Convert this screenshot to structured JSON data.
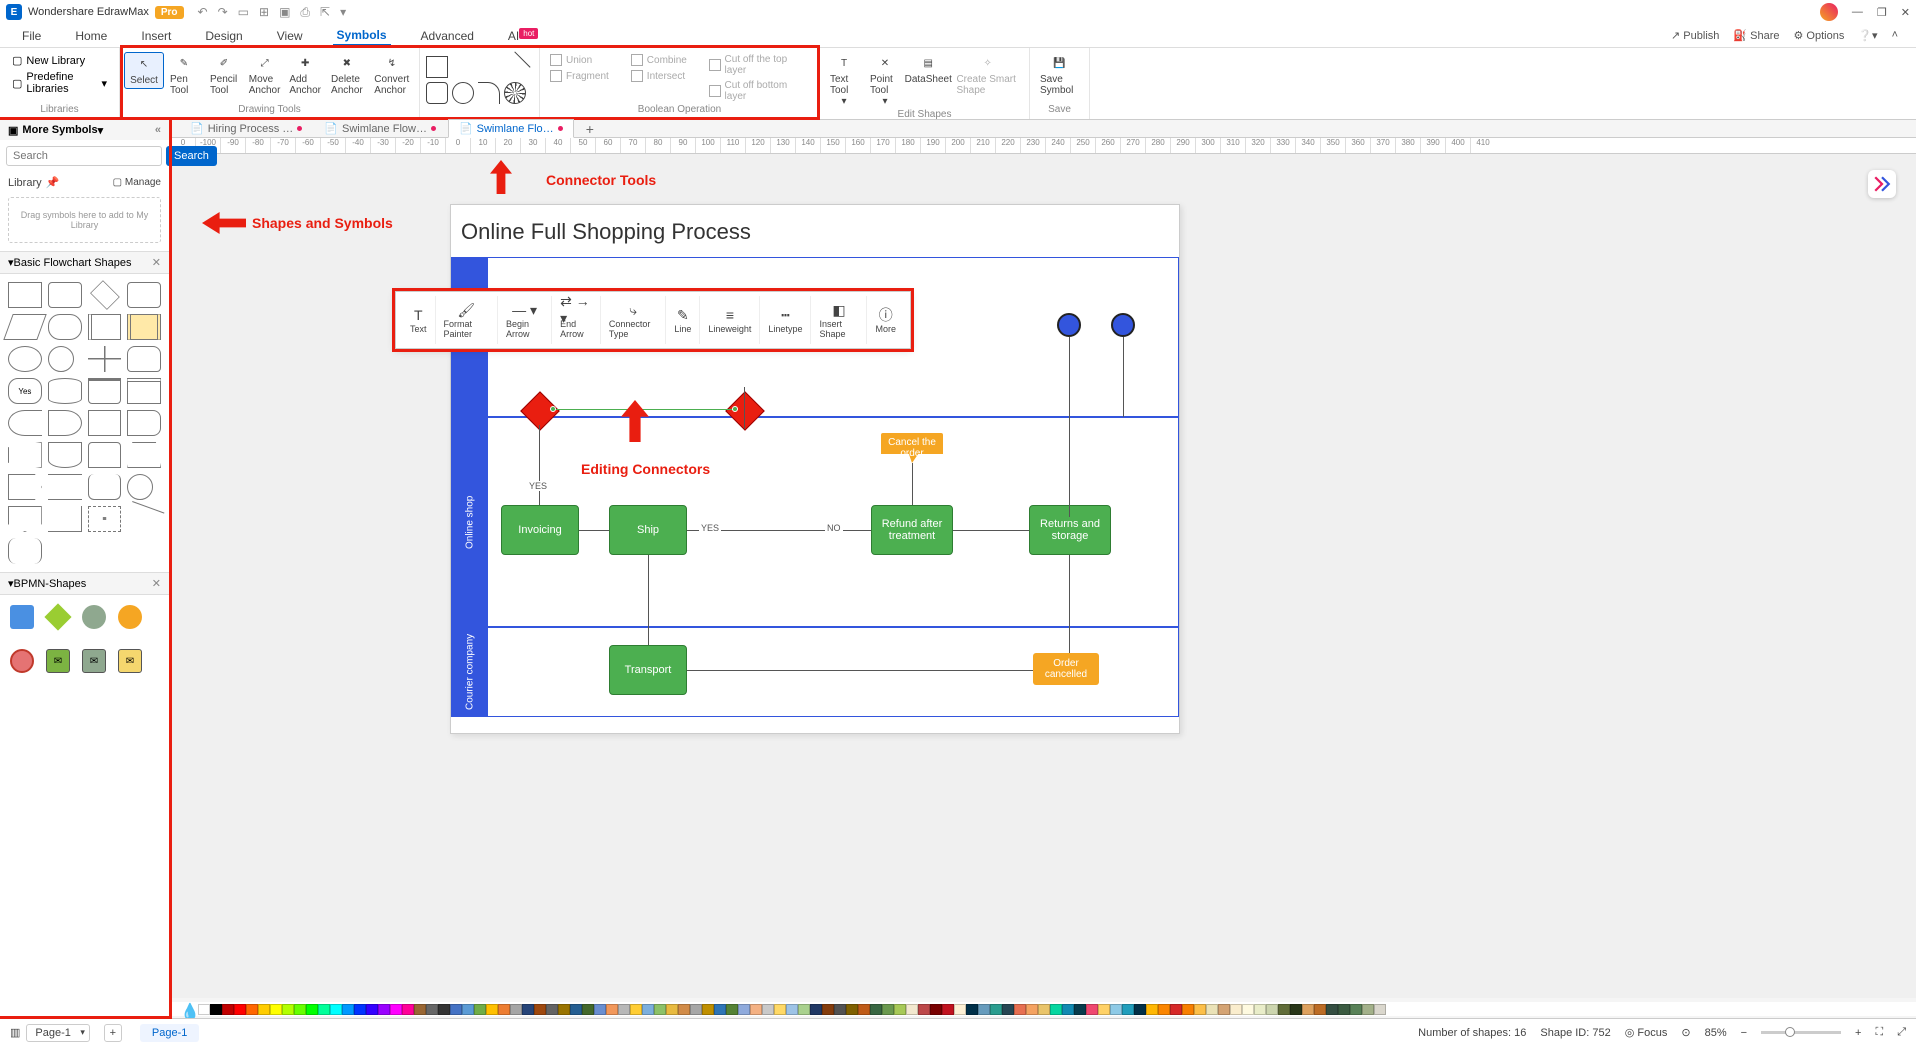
{
  "app": {
    "name": "Wondershare EdrawMax",
    "badge": "Pro"
  },
  "menu": [
    "File",
    "Home",
    "Insert",
    "Design",
    "View",
    "Symbols",
    "Advanced",
    "AI"
  ],
  "menu_active": 5,
  "menu_hot_index": 7,
  "menu_right": [
    "Publish",
    "Share",
    "Options"
  ],
  "lib_entries": [
    "New Library",
    "Predefine Libraries"
  ],
  "lib_group_label": "Libraries",
  "ribbon": {
    "drawing_tools": {
      "label": "Drawing Tools",
      "tools": [
        "Select",
        "Pen Tool",
        "Pencil Tool",
        "Move Anchor",
        "Add Anchor",
        "Delete Anchor",
        "Convert Anchor"
      ]
    },
    "boolean": {
      "label": "Boolean Operation",
      "items": [
        "Union",
        "Combine",
        "Cut off the top layer",
        "Fragment",
        "Intersect",
        "Cut off bottom layer"
      ]
    },
    "edit_shapes": {
      "label": "Edit Shapes",
      "tools": [
        "Text Tool",
        "Point Tool",
        "DataSheet",
        "Create Smart Shape"
      ]
    },
    "save": {
      "label": "Save",
      "tool": "Save Symbol"
    }
  },
  "sidebar": {
    "title": "More Symbols",
    "search_placeholder": "Search",
    "search_btn": "Search",
    "library_label": "Library",
    "manage_label": "Manage",
    "drop_hint": "Drag symbols here to add to My Library",
    "sections": [
      {
        "name": "Basic Flowchart Shapes"
      },
      {
        "name": "BPMN-Shapes"
      }
    ]
  },
  "doctabs": [
    {
      "label": "Hiring Process …",
      "active": false,
      "unsaved": true
    },
    {
      "label": "Swimlane Flow…",
      "active": false,
      "unsaved": true
    },
    {
      "label": "Swimlane Flo…",
      "active": true,
      "unsaved": true
    }
  ],
  "ruler_ticks": [
    "0",
    "-100",
    "-90",
    "-80",
    "-70",
    "-60",
    "-50",
    "-40",
    "-30",
    "-20",
    "-10",
    "0",
    "10",
    "20",
    "30",
    "40",
    "50",
    "60",
    "70",
    "80",
    "90",
    "100",
    "110",
    "120",
    "130",
    "140",
    "150",
    "160",
    "170",
    "180",
    "190",
    "200",
    "210",
    "220",
    "230",
    "240",
    "250",
    "260",
    "270",
    "280",
    "290",
    "300",
    "310",
    "320",
    "330",
    "340",
    "350",
    "360",
    "370",
    "380",
    "390",
    "400",
    "410"
  ],
  "diagram": {
    "title": "Online Full Shopping Process",
    "lanes": [
      "Online shop",
      "Courier company"
    ],
    "boxes": {
      "invoicing": "Invoicing",
      "ship": "Ship",
      "refund": "Refund after treatment",
      "returns": "Returns and storage",
      "transport": "Transport",
      "cancel": "Cancel the order",
      "order_cancelled": "Order cancelled"
    },
    "labels": {
      "yes": "YES",
      "yes2": "YES",
      "no": "NO"
    }
  },
  "float_toolbar": [
    "Text",
    "Format Painter",
    "Begin Arrow",
    "End Arrow",
    "Connector Type",
    "Line",
    "Lineweight",
    "Linetype",
    "Insert Shape",
    "More"
  ],
  "annotations": {
    "connector_tools": "Connector Tools",
    "shapes_symbols": "Shapes and Symbols",
    "editing_connectors": "Editing Connectors"
  },
  "status": {
    "page_selector": "Page-1",
    "page_tab": "Page-1",
    "shape_count": "Number of shapes: 16",
    "shape_id": "Shape ID: 752",
    "focus": "Focus",
    "zoom": "85%"
  },
  "color_palette": [
    "#ffffff",
    "#000000",
    "#c00000",
    "#ff0000",
    "#ff6600",
    "#ffcc00",
    "#ffff00",
    "#b2ff00",
    "#66ff00",
    "#00ff00",
    "#00ff99",
    "#00ffff",
    "#0099ff",
    "#0033ff",
    "#3300ff",
    "#9900ff",
    "#ff00ff",
    "#ff0099",
    "#996633",
    "#666666",
    "#333333",
    "#4472c4",
    "#5b9bd5",
    "#70ad47",
    "#ffc000",
    "#ed7d31",
    "#a5a5a5",
    "#264478",
    "#9e480e",
    "#636363",
    "#997300",
    "#255e91",
    "#43682b",
    "#698ed0",
    "#f1975a",
    "#b7b7b7",
    "#ffcd33",
    "#7cafdd",
    "#8cc168",
    "#e8ba40",
    "#d18b47",
    "#a6a6a6",
    "#bf8f00",
    "#2e75b6",
    "#548235",
    "#8faadc",
    "#f4b183",
    "#c9c9c9",
    "#ffd966",
    "#9dc3e6",
    "#a9d18e",
    "#203864",
    "#843c0c",
    "#525252",
    "#7f6000",
    "#bf5b17",
    "#386641",
    "#6a994e",
    "#a7c957",
    "#f2e8cf",
    "#bc4749",
    "#780000",
    "#c1121f",
    "#fdf0d5",
    "#003049",
    "#669bbc",
    "#2a9d8f",
    "#264653",
    "#e76f51",
    "#f4a261",
    "#e9c46a",
    "#06d6a0",
    "#118ab2",
    "#073b4c",
    "#ef476f",
    "#ffd166",
    "#8ecae6",
    "#219ebc",
    "#023047",
    "#ffb703",
    "#fb8500",
    "#d62828",
    "#f77f00",
    "#fcbf49",
    "#eae2b7",
    "#d4a373",
    "#faedcd",
    "#fefae0",
    "#e9edc9",
    "#ccd5ae",
    "#606c38",
    "#283618",
    "#dda15e",
    "#bc6c25",
    "#344e41",
    "#3a5a40",
    "#588157",
    "#a3b18a",
    "#dad7cd"
  ]
}
